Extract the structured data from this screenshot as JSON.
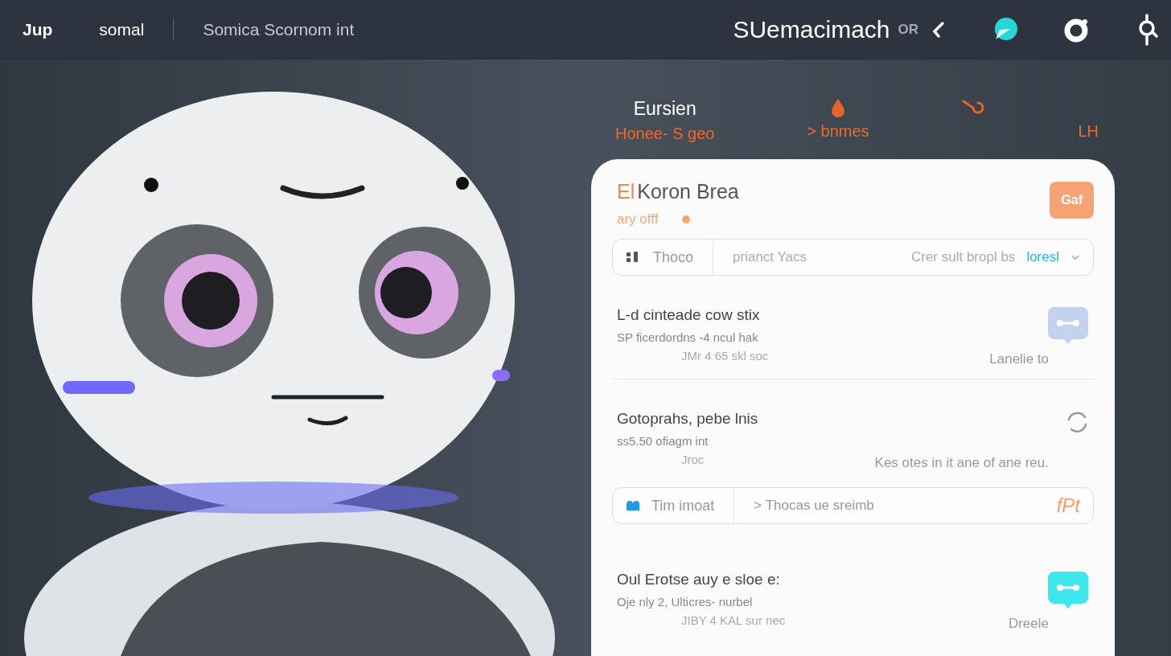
{
  "nav": {
    "logo": "Jup",
    "links": [
      "somal",
      "Somica Scornom int"
    ],
    "brand": "SUemacimach",
    "brand_badge": "OR"
  },
  "tabs": [
    {
      "kind": "stacked",
      "label": "Eursien",
      "sublabel": "Honee- S geo"
    },
    {
      "kind": "drop",
      "label": "> bnmes"
    },
    {
      "kind": "hook"
    },
    {
      "kind": "text",
      "label": "LH"
    }
  ],
  "card": {
    "title_accent": "El",
    "title": "Koron Brea",
    "subtitle": "ary offf",
    "button": "Gaf",
    "filter": {
      "label": "Thoco",
      "value": "prianct Yacs",
      "hint": "Crer sult bropl bs",
      "link": "loresl"
    },
    "items": [
      {
        "kind": "bubble",
        "color": "#c3d3ee",
        "title": "L-d cinteade cow stix",
        "lines": [
          "SP ficerdordns -4 ncul hak",
          "JMr 4 65 skl soc"
        ],
        "note": "Lanelie to"
      },
      {
        "kind": "spinner",
        "title": "Gotoprahs, pebe lnis",
        "lines": [
          "ss5.50 ofiagm int",
          "Jroc"
        ],
        "note": "Kes otes in it ane of ane reu."
      },
      {
        "kind": "filter",
        "label": "Tim imoat",
        "value": "> Thocas ue sreimb",
        "tag": "fPt"
      },
      {
        "kind": "bubble",
        "color": "#3de8ec",
        "title": "Oul Erotse auy e sloe e:",
        "lines": [
          "Oje nly 2, Ulticres- nurbel",
          "JIBY 4 KAL sur nec"
        ],
        "note": "Dreele"
      }
    ]
  }
}
